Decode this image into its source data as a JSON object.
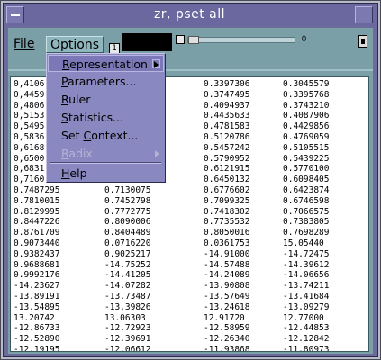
{
  "window": {
    "title": "zr, pset all"
  },
  "menubar": {
    "file_label": "File",
    "options_label": "Options"
  },
  "toolbar": {
    "small_box_label": "1",
    "slider_value": "0",
    "slider_icon": "square-icon",
    "right_icon": "bell-icon"
  },
  "options_menu": {
    "items": [
      {
        "label": "Representation",
        "underline": "R",
        "submenu": true,
        "enabled": true,
        "selected": true
      },
      {
        "label": "Parameters...",
        "underline": "P",
        "submenu": false,
        "enabled": true
      },
      {
        "label": "Ruler",
        "underline": "R",
        "submenu": false,
        "enabled": true
      },
      {
        "label": "Statistics...",
        "underline": "S",
        "submenu": false,
        "enabled": true
      },
      {
        "label": "Set Context...",
        "underline": "C",
        "submenu": false,
        "enabled": true
      },
      {
        "label": "Radix",
        "underline": "R",
        "submenu": true,
        "enabled": false
      },
      {
        "label": "Help",
        "underline": "H",
        "submenu": false,
        "enabled": true
      }
    ]
  },
  "table": {
    "rows": [
      [
        "0,4106",
        "",
        "0.3397306",
        "0.3045579"
      ],
      [
        "0,4459",
        "",
        "0.3747495",
        "0.3395768"
      ],
      [
        "0,4806",
        "",
        "0.4094937",
        "0.3743210"
      ],
      [
        "0,5153",
        "",
        "0.4435633",
        "0.4087906"
      ],
      [
        "0,5495",
        "",
        "0.4781583",
        "0.4429856"
      ],
      [
        "0,5836",
        "",
        "0.5120786",
        "0.4769059"
      ],
      [
        "0,6168",
        "",
        "0.5457242",
        "0.5105515"
      ],
      [
        "0,6500",
        "",
        "0.5790952",
        "0.5439225"
      ],
      [
        "0,6831",
        "",
        "0.6121915",
        "0.5770100"
      ],
      [
        "0,7160",
        "",
        "0.6450132",
        "0.6098405"
      ],
      [
        "0.7487295",
        "0.7130075",
        "0.6776602",
        "0.6423874"
      ],
      [
        "0.7810015",
        "0.7452798",
        "0.7099325",
        "0.6746598"
      ],
      [
        "0.8129995",
        "0.7772775",
        "0.7418302",
        "0.7066575"
      ],
      [
        "0.8447226",
        "0.8090006",
        "0.7735532",
        "0.7383805"
      ],
      [
        "0.8761709",
        "0.8404489",
        "0.8050016",
        "0.7698289"
      ],
      [
        "0.9073440",
        "0.0716220",
        "0.0361753",
        "15.05440"
      ],
      [
        "0.9382437",
        "0.9025217",
        "-14.91000",
        "-14.72475"
      ],
      [
        "0.9688681",
        "-14.75252",
        "-14.57488",
        "-14.39612"
      ],
      [
        "0.9992176",
        "-14.41205",
        "-14.24089",
        "-14.06656"
      ],
      [
        "-14.23627",
        "-14.07282",
        "-13.90808",
        "-13.74211"
      ],
      [
        "-13.89191",
        "-13.73487",
        "-13.57649",
        "-13.41684"
      ],
      [
        "-13.54895",
        "-13.39826",
        "-13.24618",
        "-13.09279"
      ],
      [
        "13.20742",
        "13.06303",
        "12.91720",
        "12.77000"
      ],
      [
        "-12.86733",
        "-12.72923",
        "-12.58959",
        "-12.44853"
      ],
      [
        "-12.52890",
        "-12.39691",
        "-12.26340",
        "-12.12842"
      ],
      [
        "-12.19195",
        "-12.06612",
        "-11.93868",
        "-11.80973"
      ]
    ]
  }
}
